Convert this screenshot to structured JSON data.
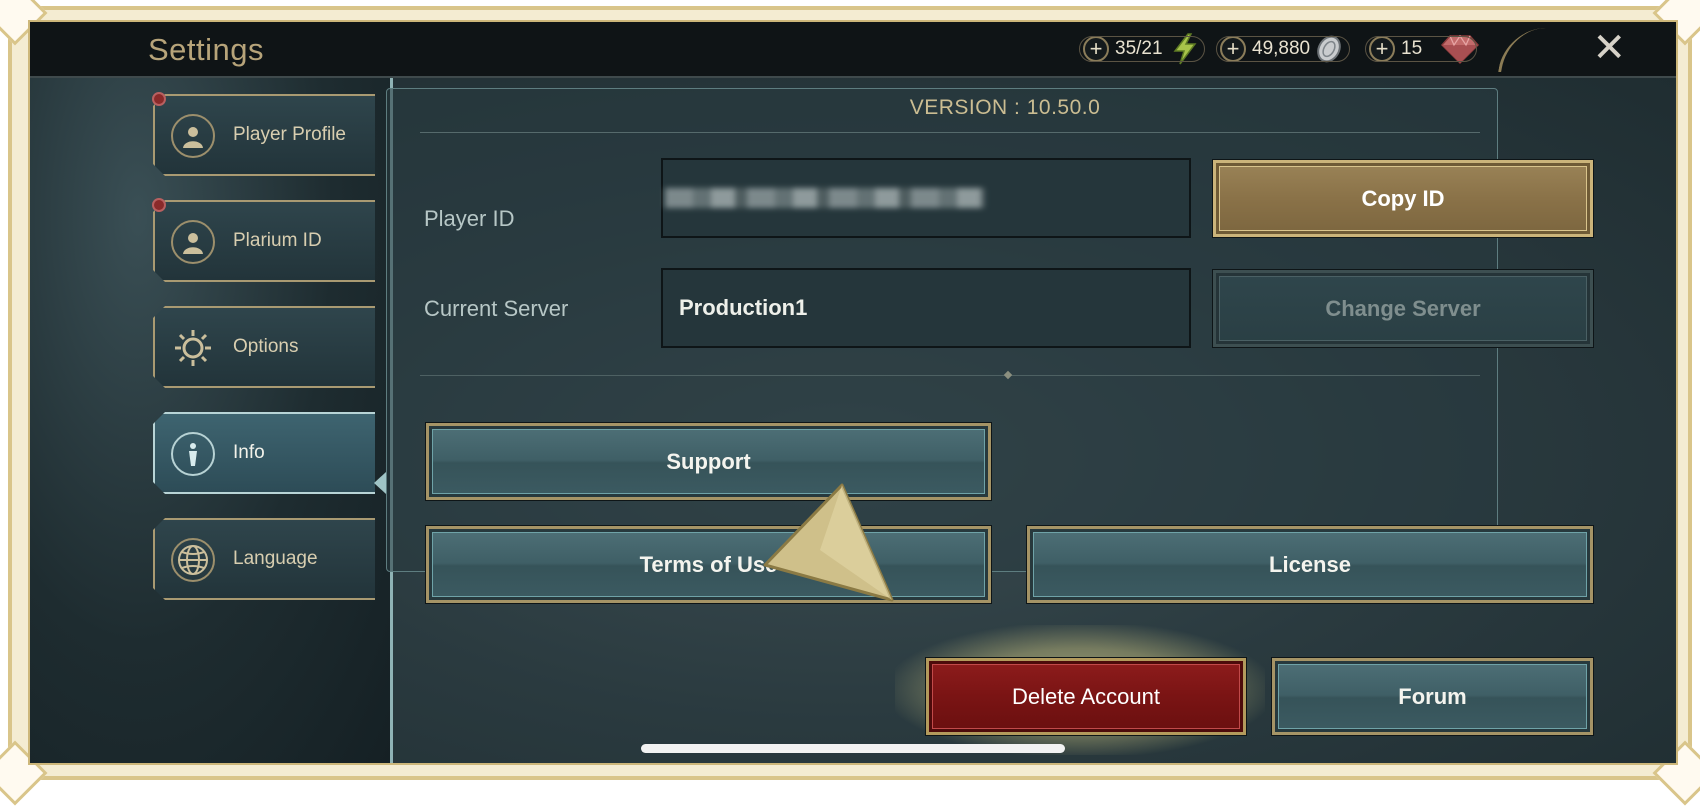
{
  "window": {
    "title": "Settings"
  },
  "resources": [
    {
      "value": "35/21",
      "icon": "lightning-icon"
    },
    {
      "value": "49,880",
      "icon": "silver-coin-icon"
    },
    {
      "value": "15",
      "icon": "gem-icon"
    }
  ],
  "sidebar": {
    "items": [
      {
        "label": "Player Profile",
        "icon": "person-icon",
        "notification": true
      },
      {
        "label": "Plarium ID",
        "icon": "person-icon",
        "notification": true
      },
      {
        "label": "Options",
        "icon": "gear-icon",
        "notification": false
      },
      {
        "label": "Info",
        "icon": "info-icon",
        "active": true
      },
      {
        "label": "Language",
        "icon": "globe-icon",
        "notification": false
      }
    ]
  },
  "info": {
    "version": "VERSION : 10.50.0",
    "player_id_label": "Player ID",
    "current_server_label": "Current Server",
    "current_server_value": "Production1",
    "copy_id_label": "Copy ID",
    "change_server_label": "Change Server",
    "support_label": "Support",
    "terms_label": "Terms of Use",
    "license_label": "License",
    "delete_account_label": "Delete Account",
    "forum_label": "Forum"
  },
  "colors": {
    "accent_gold": "#cbb47a",
    "delete_red": "#7a1414",
    "panel_teal": "#3f5f66"
  }
}
